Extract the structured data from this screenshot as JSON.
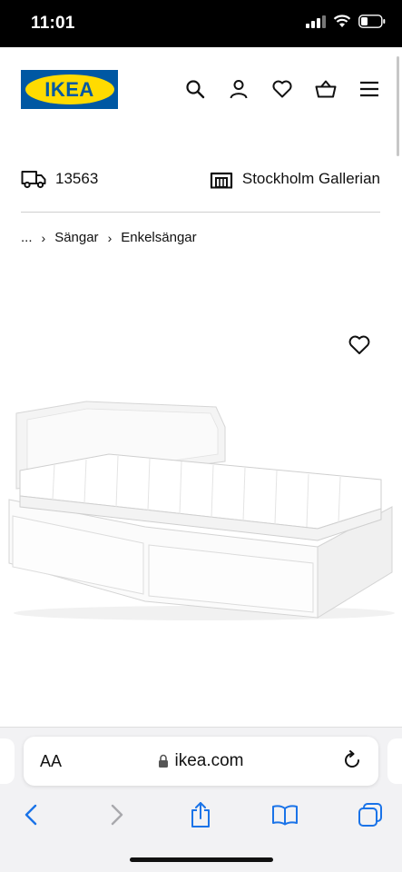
{
  "status_bar": {
    "time": "11:01"
  },
  "header": {
    "logo_text": "IKEA",
    "icons": [
      "search-icon",
      "user-icon",
      "heart-icon",
      "basket-icon",
      "menu-icon"
    ]
  },
  "location": {
    "postal_code": "13563",
    "store_name": "Stockholm Gallerian"
  },
  "breadcrumb": {
    "ellipsis": "...",
    "items": [
      "Sängar",
      "Enkelsängar"
    ]
  },
  "product": {
    "image_alt": "white daybed with mattress and drawers"
  },
  "browser": {
    "text_size_label": "AA",
    "url": "ikea.com"
  },
  "colors": {
    "ikea_blue": "#0058a3",
    "ikea_yellow": "#ffdb00",
    "ios_blue": "#1a73e8"
  }
}
